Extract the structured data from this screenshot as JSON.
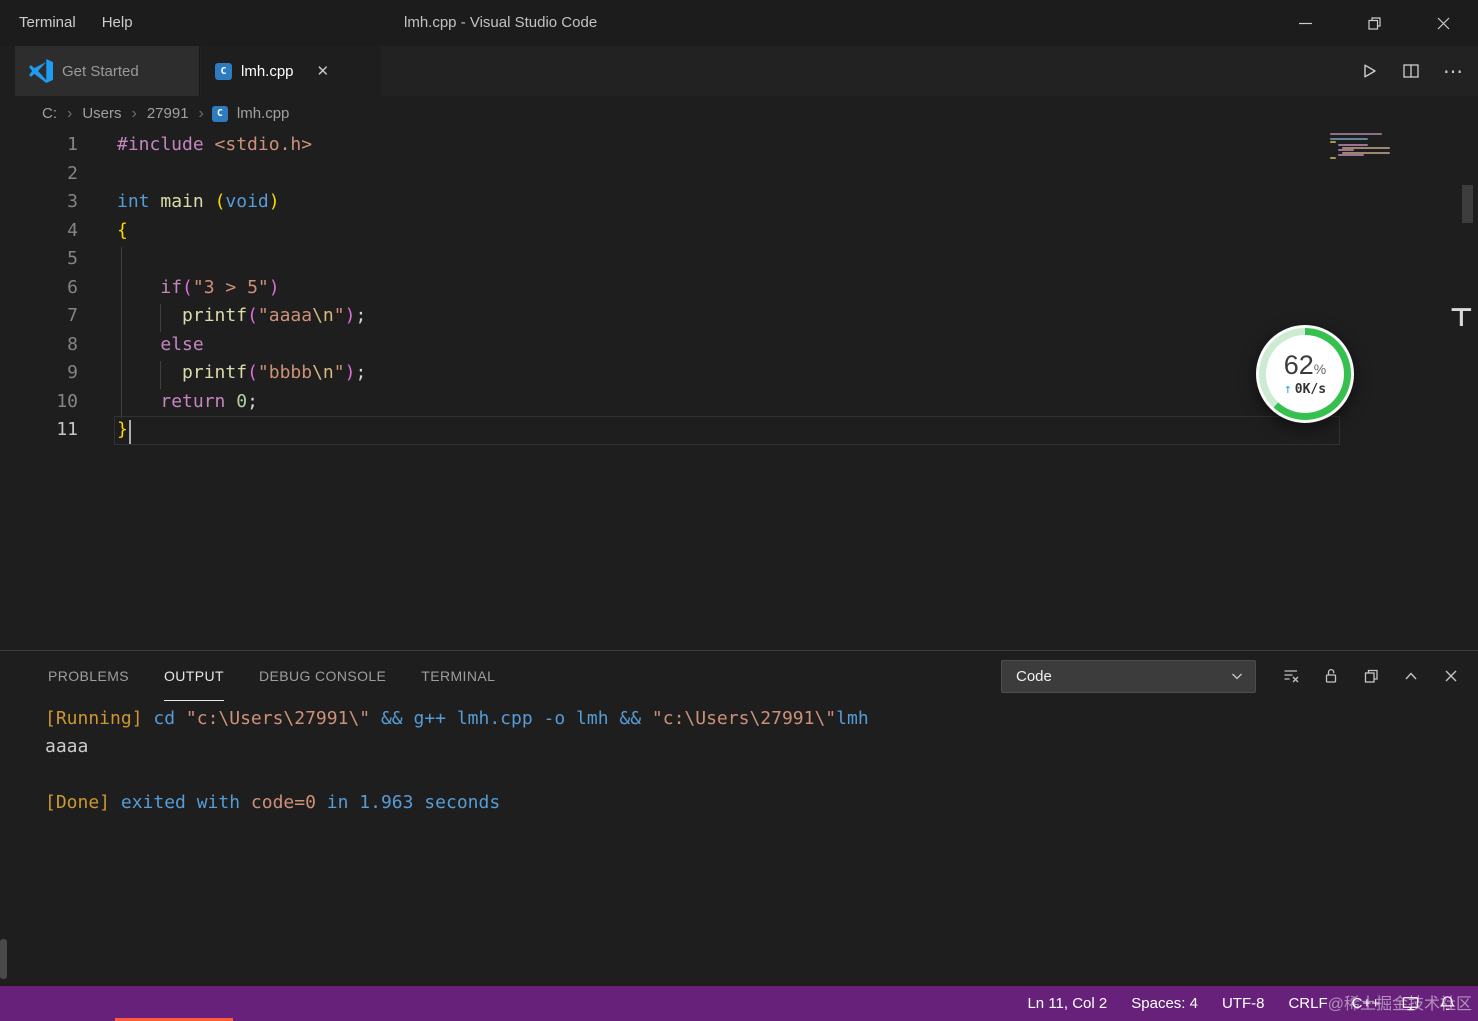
{
  "title_bar": {
    "menus": [
      "Terminal",
      "Help"
    ],
    "title": "lmh.cpp - Visual Studio Code"
  },
  "icons": {
    "cpp": "C"
  },
  "tab_bar": {
    "tabs": [
      {
        "label": "Get Started",
        "active": false
      },
      {
        "label": "lmh.cpp",
        "active": true
      }
    ],
    "close_glyph": "✕"
  },
  "breadcrumb": {
    "items": [
      "C:",
      "Users",
      "27991",
      "lmh.cpp"
    ],
    "separator": "›"
  },
  "editor": {
    "cursor": {
      "line": 11,
      "col": 2
    },
    "lines": [
      {
        "n": "1",
        "tokens": [
          [
            "#include",
            "kw"
          ],
          [
            " ",
            "pl"
          ],
          [
            "<stdio.h>",
            "str"
          ]
        ]
      },
      {
        "n": "2",
        "tokens": []
      },
      {
        "n": "3",
        "tokens": [
          [
            "int",
            "type"
          ],
          [
            " ",
            "pl"
          ],
          [
            "main",
            "fn"
          ],
          [
            " ",
            "pl"
          ],
          [
            "(",
            "br1"
          ],
          [
            "void",
            "type"
          ],
          [
            ")",
            "br1"
          ]
        ]
      },
      {
        "n": "4",
        "tokens": [
          [
            "{",
            "br1"
          ]
        ]
      },
      {
        "n": "5",
        "tokens": []
      },
      {
        "n": "6",
        "tokens": [
          [
            "    ",
            "pl"
          ],
          [
            "if",
            "kw"
          ],
          [
            "(",
            "br2"
          ],
          [
            "\"3 > 5\"",
            "str"
          ],
          [
            ")",
            "br2"
          ]
        ]
      },
      {
        "n": "7",
        "tokens": [
          [
            "      ",
            "pl"
          ],
          [
            "printf",
            "fn"
          ],
          [
            "(",
            "br2"
          ],
          [
            "\"aaaa",
            "str"
          ],
          [
            "\\n",
            "esc"
          ],
          [
            "\"",
            "str"
          ],
          [
            ")",
            "br2"
          ],
          [
            ";",
            "pl"
          ]
        ]
      },
      {
        "n": "8",
        "tokens": [
          [
            "    ",
            "pl"
          ],
          [
            "else",
            "kw"
          ]
        ]
      },
      {
        "n": "9",
        "tokens": [
          [
            "      ",
            "pl"
          ],
          [
            "printf",
            "fn"
          ],
          [
            "(",
            "br2"
          ],
          [
            "\"bbbb",
            "str"
          ],
          [
            "\\n",
            "esc"
          ],
          [
            "\"",
            "str"
          ],
          [
            ")",
            "br2"
          ],
          [
            ";",
            "pl"
          ]
        ]
      },
      {
        "n": "10",
        "tokens": [
          [
            "    ",
            "pl"
          ],
          [
            "return",
            "kw"
          ],
          [
            " ",
            "pl"
          ],
          [
            "0",
            "num"
          ],
          [
            ";",
            "pl"
          ]
        ]
      },
      {
        "n": "11",
        "tokens": [
          [
            "}",
            "br1"
          ]
        ],
        "current": true
      }
    ]
  },
  "overlay_widget": {
    "percent": "62",
    "unit": "%",
    "arrow": "↑",
    "speed": "0K/s"
  },
  "right_edge_glyph": "⊤",
  "panel": {
    "tabs": [
      {
        "label": "PROBLEMS",
        "active": false
      },
      {
        "label": "OUTPUT",
        "active": true
      },
      {
        "label": "DEBUG CONSOLE",
        "active": false
      },
      {
        "label": "TERMINAL",
        "active": false
      }
    ],
    "channel": "Code",
    "output_lines": [
      {
        "tokens": [
          [
            "[Running] ",
            "tag"
          ],
          [
            "cd ",
            "cmd"
          ],
          [
            "\"c:\\Users\\27991\\\" ",
            "strr"
          ],
          [
            "&& g++ lmh.cpp -o lmh && ",
            "cmd"
          ],
          [
            "\"c:\\Users\\27991\\\"",
            "strr"
          ],
          [
            "lmh",
            "cmd"
          ]
        ]
      },
      {
        "tokens": [
          [
            "aaaa",
            "out"
          ]
        ]
      },
      {
        "tokens": []
      },
      {
        "tokens": [
          [
            "[Done] ",
            "tag"
          ],
          [
            "exited with ",
            "cmd"
          ],
          [
            "code=0",
            "strr"
          ],
          [
            " in 1.963 seconds",
            "cmd"
          ]
        ]
      }
    ]
  },
  "status_bar": {
    "items": [
      "Ln 11, Col 2",
      "Spaces: 4",
      "UTF-8",
      "CRLF",
      "C++"
    ],
    "watermark": "@稀土掘金技术社区"
  }
}
